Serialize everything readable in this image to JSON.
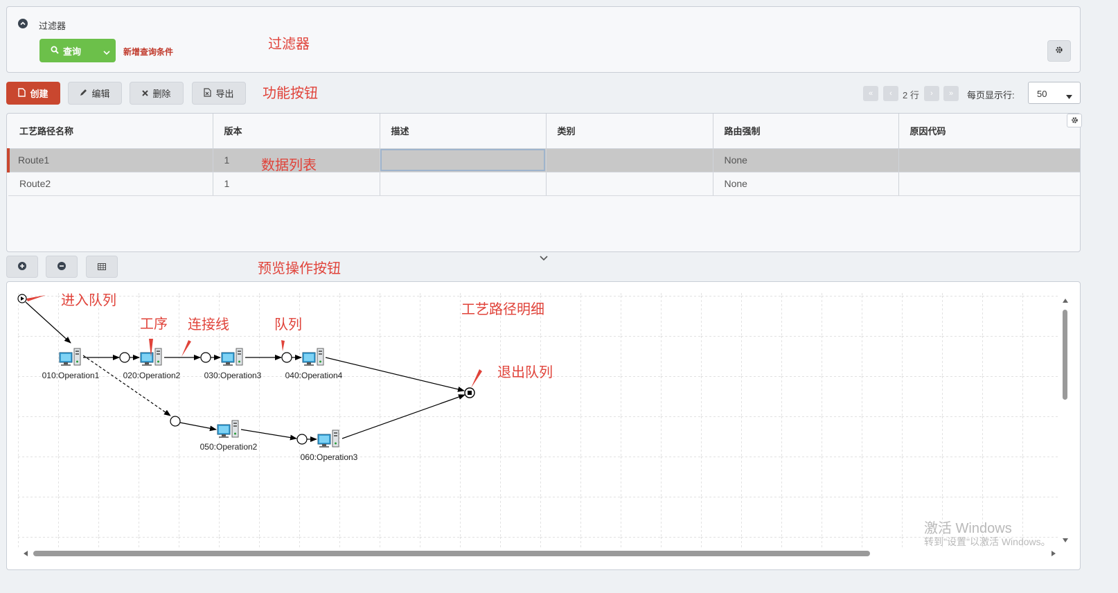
{
  "filter": {
    "title": "过滤器",
    "query_label": "查询",
    "add_condition": "新增查询条件"
  },
  "toolbar": {
    "create": "创建",
    "edit": "编辑",
    "delete": "删除",
    "export": "导出"
  },
  "pager": {
    "rows": "2 行",
    "per_page_label": "每页显示行:",
    "per_page_value": "50"
  },
  "table": {
    "columns": [
      "工艺路径名称",
      "版本",
      "描述",
      "类别",
      "路由强制",
      "原因代码"
    ],
    "rows": [
      {
        "name": "Route1",
        "version": "1",
        "desc": "",
        "category": "",
        "force": "None",
        "reason": ""
      },
      {
        "name": "Route2",
        "version": "1",
        "desc": "",
        "category": "",
        "force": "None",
        "reason": ""
      }
    ]
  },
  "diagram": {
    "nodes": [
      "010:Operation1",
      "020:Operation2",
      "030:Operation3",
      "040:Operation4",
      "050:Operation2",
      "060:Operation3"
    ]
  },
  "annotations": {
    "filter": "过滤器",
    "buttons": "功能按钮",
    "list": "数据列表",
    "preview_buttons": "预览操作按钮",
    "enter_queue": "进入队列",
    "operation": "工序",
    "connector": "连接线",
    "queue": "队列",
    "route_detail": "工艺路径明细",
    "exit_queue": "退出队列"
  },
  "watermark": {
    "line1": "激活 Windows",
    "line2": "转到\"设置\"以激活 Windows。"
  },
  "colors": {
    "create_button": "#c9472f",
    "query_button": "#6cc04a",
    "annotation": "#e0433a",
    "selected_row": "#c8c8c8"
  }
}
